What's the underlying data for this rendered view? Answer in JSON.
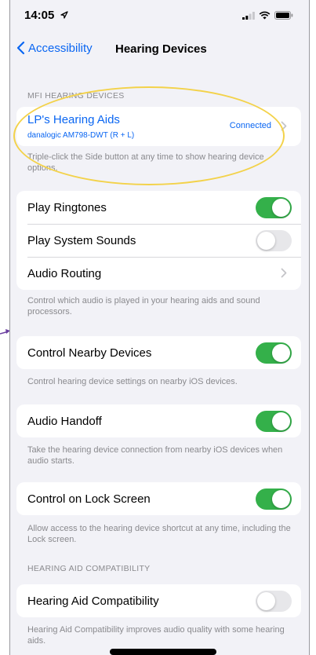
{
  "status_bar": {
    "time": "14:05",
    "icons": [
      "location-arrow-icon",
      "signal-bars-icon",
      "wifi-icon",
      "battery-icon"
    ]
  },
  "nav": {
    "back_label": "Accessibility",
    "title": "Hearing Devices"
  },
  "mfi_section": {
    "header": "MFI HEARING DEVICES",
    "device_name": "LP's Hearing Aids",
    "device_model": "danalogic AM798-DWT (R + L)",
    "device_status": "Connected",
    "footer": "Triple-click the Side button at any time to show hearing device options."
  },
  "audio_section": {
    "rows": [
      {
        "label": "Play Ringtones",
        "on": true
      },
      {
        "label": "Play System Sounds",
        "on": false
      },
      {
        "label": "Audio Routing"
      }
    ],
    "footer": "Control which audio is played in your hearing aids and sound processors."
  },
  "nearby_section": {
    "label": "Control Nearby Devices",
    "on": true,
    "footer": "Control hearing device settings on nearby iOS devices."
  },
  "handoff_section": {
    "label": "Audio Handoff",
    "on": true,
    "footer": "Take the hearing device connection from nearby iOS devices when audio starts."
  },
  "lock_section": {
    "label": "Control on Lock Screen",
    "on": true,
    "footer": "Allow access to the hearing device shortcut at any time, including the Lock screen."
  },
  "hac_section": {
    "header": "HEARING AID COMPATIBILITY",
    "label": "Hearing Aid Compatibility",
    "on": false,
    "footer": "Hearing Aid Compatibility improves audio quality with some hearing aids."
  },
  "colors": {
    "accent": "#0a66f2",
    "toggle_on": "#34b04a",
    "toggle_off": "#e7e7ea",
    "highlight": "#f3d24a",
    "annotation_arrow": "#6b3fa0"
  }
}
